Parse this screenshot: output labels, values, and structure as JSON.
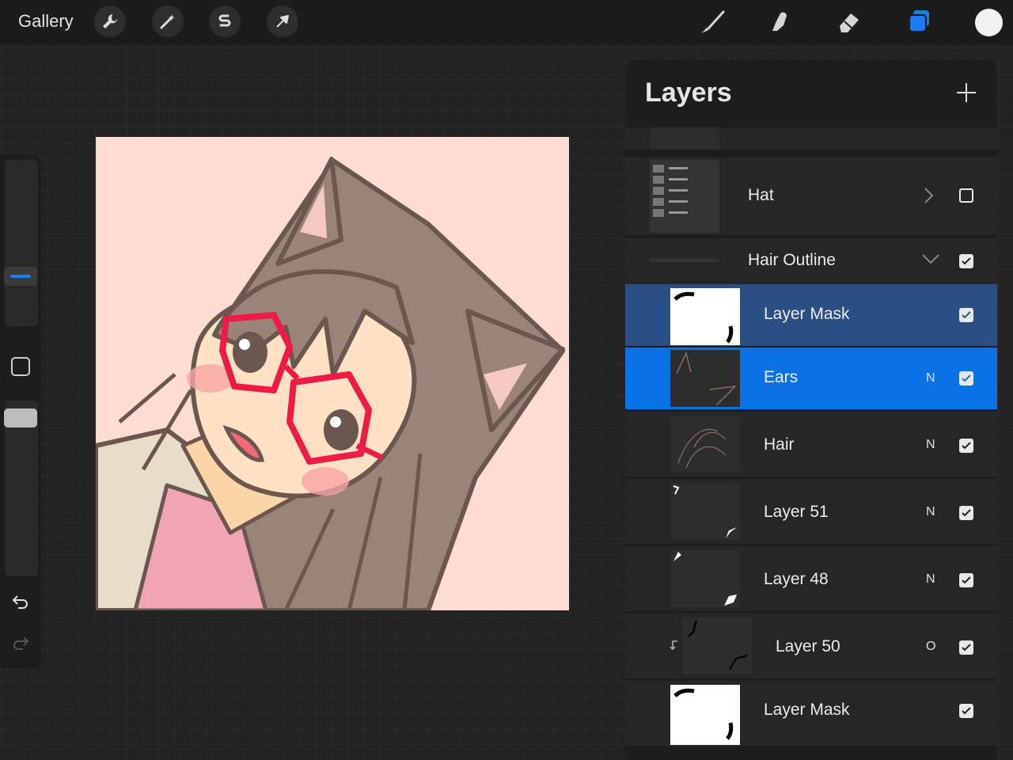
{
  "toolbar": {
    "gallery_label": "Gallery",
    "left_tools": [
      "wrench-icon",
      "magic-wand-icon",
      "selection-icon",
      "transform-arrow-icon"
    ],
    "right_tools": [
      "brush-icon",
      "smudge-icon",
      "eraser-icon",
      "layers-icon"
    ],
    "active_tool": "layers-icon",
    "current_color": "#f2f2f2",
    "accent_color": "#1a7cf0"
  },
  "sidebar": {
    "brush_size_slider": "slider",
    "modify_button": "square-icon",
    "opacity_slider": "slider",
    "undo_icon": "undo-icon",
    "redo_icon": "redo-icon"
  },
  "layers_panel": {
    "title": "Layers",
    "add_icon": "plus-icon",
    "layers": [
      {
        "name": "Hat",
        "blend": "",
        "checked": false,
        "type": "group-collapsed"
      },
      {
        "name": "Hair Outline",
        "blend": "",
        "checked": true,
        "type": "group-expanded"
      },
      {
        "name": "Layer Mask",
        "blend": "",
        "checked": true,
        "type": "mask",
        "state": "selected-secondary"
      },
      {
        "name": "Ears",
        "blend": "N",
        "checked": true,
        "state": "selected-primary"
      },
      {
        "name": "Hair",
        "blend": "N",
        "checked": true
      },
      {
        "name": "Layer 51",
        "blend": "N",
        "checked": true
      },
      {
        "name": "Layer 48",
        "blend": "N",
        "checked": true
      },
      {
        "name": "Layer 50",
        "blend": "O",
        "checked": true,
        "clipped": true
      },
      {
        "name": "Layer Mask",
        "blend": "",
        "checked": true,
        "type": "mask"
      }
    ]
  },
  "colors": {
    "canvas_background": "#ffdcd2",
    "selected_primary": "#0a72e6",
    "selected_secondary": "#2b4f85"
  }
}
